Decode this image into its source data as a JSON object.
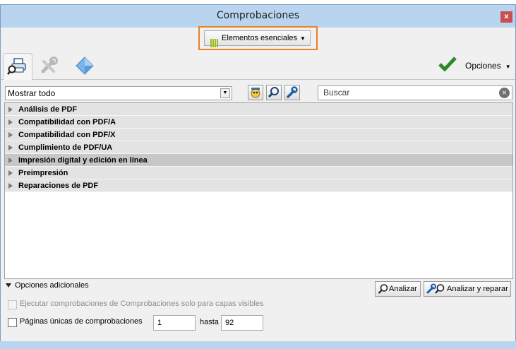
{
  "window": {
    "title": "Comprobaciones",
    "close_glyph": "x"
  },
  "profile": {
    "label": "Elementos esenciales",
    "icon": "bars-icon"
  },
  "tabs": [
    {
      "name": "fixups-tab",
      "icon": "printer-magnifier-icon",
      "active": true
    },
    {
      "name": "fixups-tools-tab",
      "icon": "wrench-cross-icon",
      "active": false
    },
    {
      "name": "single-checks-tab",
      "icon": "blue-diamond-icon",
      "active": false
    }
  ],
  "header_right": {
    "status_icon": "green-check-icon",
    "options_label": "Opciones"
  },
  "filter": {
    "selected": "Mostrar todo"
  },
  "tools": [
    "favorites-icon",
    "magnifier-icon",
    "wrench-icon"
  ],
  "search": {
    "placeholder": "Buscar"
  },
  "groups": [
    {
      "label": "Análisis de PDF",
      "selected": false
    },
    {
      "label": "Compatibilidad con PDF/A",
      "selected": false
    },
    {
      "label": "Compatibilidad con PDF/X",
      "selected": false
    },
    {
      "label": "Cumplimiento de PDF/UA",
      "selected": false
    },
    {
      "label": "Impresión digital y edición en línea",
      "selected": true
    },
    {
      "label": "Preimpresión",
      "selected": false
    },
    {
      "label": "Reparaciones de PDF",
      "selected": false
    }
  ],
  "footer": {
    "additional_options": "Opciones adicionales",
    "analyze_label": "Analizar",
    "analyze_fix_label": "Analizar y reparar",
    "visible_layers_label": "Ejecutar comprobaciones de Comprobaciones solo para capas visibles",
    "pages_label": "Páginas únicas de comprobaciones",
    "from_value": "1",
    "to_label": "hasta",
    "to_value": "92"
  },
  "colors": {
    "accent_border": "#e8831f",
    "titlebar": "#b9d4ef",
    "check": "#2a8a2a"
  }
}
